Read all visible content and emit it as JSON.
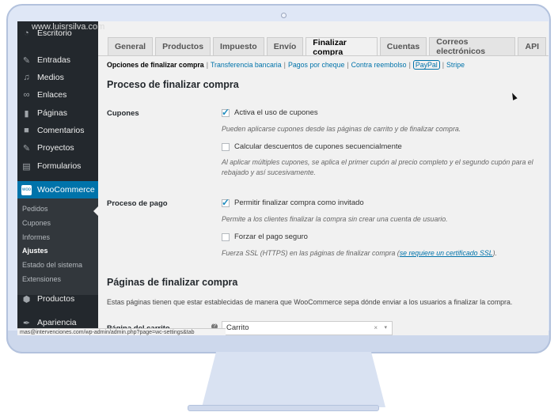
{
  "watermark": "www.luisrsilva.com",
  "sidebar": {
    "items": [
      {
        "label": "Escritorio",
        "icon": "dashboard-icon"
      },
      {
        "label": "Entradas",
        "icon": "pin-icon"
      },
      {
        "label": "Medios",
        "icon": "media-icon"
      },
      {
        "label": "Enlaces",
        "icon": "link-icon"
      },
      {
        "label": "Páginas",
        "icon": "page-icon"
      },
      {
        "label": "Comentarios",
        "icon": "comment-icon"
      },
      {
        "label": "Proyectos",
        "icon": "pin-icon"
      },
      {
        "label": "Formularios",
        "icon": "form-icon"
      },
      {
        "label": "WooCommerce",
        "icon": "woo-icon"
      },
      {
        "label": "Productos",
        "icon": "box-icon"
      },
      {
        "label": "Apariencia",
        "icon": "brush-icon"
      }
    ],
    "woo_submenu": [
      "Pedidos",
      "Cupones",
      "Informes",
      "Ajustes",
      "Estado del sistema",
      "Extensiones"
    ]
  },
  "statusbar": "mas@intervenciones.com/wp-admin/admin.php?page=wc-settings&tab",
  "tabs": [
    "General",
    "Productos",
    "Impuesto",
    "Envío",
    "Finalizar compra",
    "Cuentas",
    "Correos electrónicos",
    "API"
  ],
  "subnav": [
    "Opciones de finalizar compra",
    "Transferencia bancaria",
    "Pagos por cheque",
    "Contra reembolso",
    "PayPal",
    "Stripe"
  ],
  "section_title": "Proceso de finalizar compra",
  "coupons": {
    "label": "Cupones",
    "opt1": "Activa el uso de cupones",
    "opt1_checked": true,
    "desc1": "Pueden aplicarse cupones desde las páginas de carrito y de finalizar compra.",
    "opt2": "Calcular descuentos de cupones secuencialmente",
    "opt2_checked": false,
    "desc2a": "Al aplicar múltiples cupones, se aplica el primer cupón al precio completo y el segundo cupón para el",
    "desc2b": "rebajado y así sucesivamente."
  },
  "checkout": {
    "label": "Proceso de pago",
    "opt1": "Permitir finalizar compra como invitado",
    "opt1_checked": true,
    "desc1": "Permite a los clientes finalizar la compra sin crear una cuenta de usuario.",
    "opt2": "Forzar el pago seguro",
    "opt2_checked": false,
    "desc2_pre": "Fuerza SSL (HTTPS) en las páginas de finalizar compra (",
    "desc2_link": "se requiere un certificado SSL",
    "desc2_post": ")."
  },
  "pages_section": {
    "title": "Páginas de finalizar compra",
    "intro": "Estas páginas tienen que estar establecidas de manera que WooCommerce sepa dónde enviar a los usuarios a finalizar la compra.",
    "cart_label": "Página del carrito",
    "cart_value": "Carrito",
    "clear_glyph": "×",
    "dropdown_glyph": "▾"
  }
}
